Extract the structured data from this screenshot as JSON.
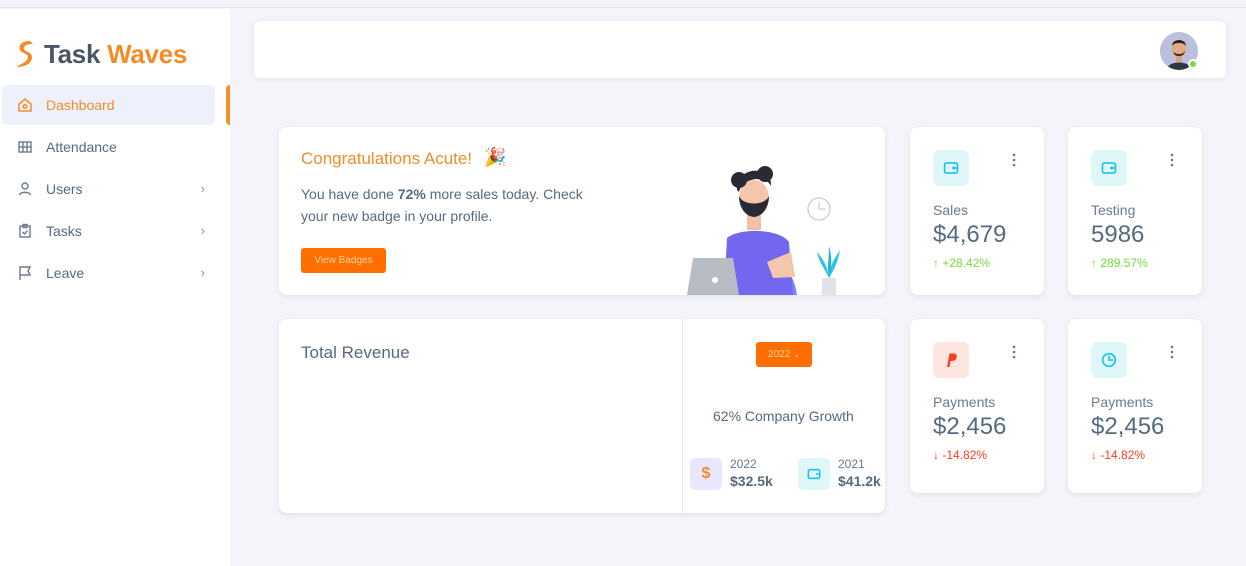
{
  "brand": {
    "name_part1": "Task",
    "name_part2": "Waves"
  },
  "sidebar": {
    "items": [
      {
        "label": "Dashboard",
        "icon": "home-icon",
        "active": true,
        "has_submenu": false
      },
      {
        "label": "Attendance",
        "icon": "grid-icon",
        "active": false,
        "has_submenu": false
      },
      {
        "label": "Users",
        "icon": "user-icon",
        "active": false,
        "has_submenu": true
      },
      {
        "label": "Tasks",
        "icon": "clipboard-icon",
        "active": false,
        "has_submenu": true
      },
      {
        "label": "Leave",
        "icon": "flag-icon",
        "active": false,
        "has_submenu": true
      }
    ]
  },
  "navbar": {
    "avatar": "user-avatar",
    "status": "online"
  },
  "welcome": {
    "title": "Congratulations Acute!",
    "emoji": "🎉",
    "text_before": "You have done ",
    "text_bold": "72%",
    "text_after": " more sales today. Check your new badge in your profile.",
    "button": "View Badges"
  },
  "stats": [
    {
      "label": "Sales",
      "value": "$4,679",
      "change": "+28.42%",
      "direction": "up",
      "icon": "wallet-icon",
      "icon_bg": "#e0f7fa",
      "icon_color": "#03c3ec"
    },
    {
      "label": "Testing",
      "value": "5986",
      "change": "289.57%",
      "direction": "up",
      "icon": "wallet-icon",
      "icon_bg": "#e0f7fa",
      "icon_color": "#03c3ec"
    },
    {
      "label": "Payments",
      "value": "$2,456",
      "change": "-14.82%",
      "direction": "down",
      "icon": "paypal-icon",
      "icon_bg": "#ffe5e0",
      "icon_color": "#ff3e1d"
    },
    {
      "label": "Payments",
      "value": "$2,456",
      "change": "-14.82%",
      "direction": "down",
      "icon": "clock-icon",
      "icon_bg": "#e0f7fa",
      "icon_color": "#03c3ec"
    }
  ],
  "revenue": {
    "title": "Total Revenue",
    "year_select": "2022",
    "growth": "62% Company Growth",
    "items": [
      {
        "year": "2022",
        "value": "$32.5k",
        "icon": "dollar-icon"
      },
      {
        "year": "2021",
        "value": "$41.2k",
        "icon": "wallet-icon"
      }
    ]
  },
  "colors": {
    "accent": "#f28c28",
    "button": "#ff6f00",
    "success": "#71dd37",
    "danger": "#ff3e1d",
    "info": "#03c3ec"
  }
}
